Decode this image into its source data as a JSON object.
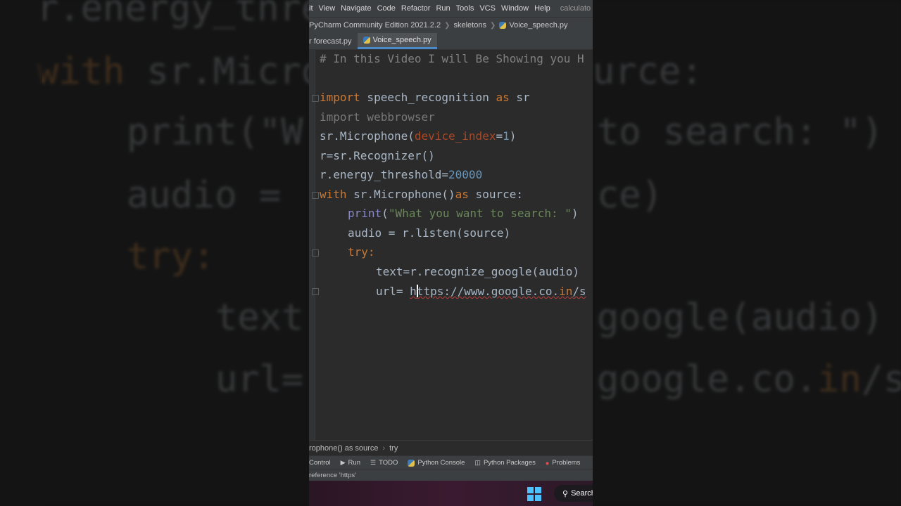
{
  "menubar": {
    "items": [
      "it",
      "View",
      "Navigate",
      "Code",
      "Refactor",
      "Run",
      "Tools",
      "VCS",
      "Window",
      "Help"
    ],
    "title_fragment": "calculato"
  },
  "breadcrumb": {
    "items": [
      "PyCharm Community Edition 2021.2.2",
      "skeletons",
      "Voice_speech.py"
    ]
  },
  "tabs": [
    {
      "label": "r forecast.py",
      "active": false
    },
    {
      "label": "Voice_speech.py",
      "active": true
    }
  ],
  "code": {
    "comment": "# In this Video I will Be Showing you H",
    "import_kw": "import",
    "import_mod": " speech_recognition ",
    "as_kw": "as",
    "import_alias": " sr",
    "import2": "import webbrowser",
    "mic_prefix": "sr.Microphone(",
    "mic_param": "device_index",
    "mic_eq": "=",
    "mic_val": "1",
    "mic_close": ")",
    "rec": "r=sr.Recognizer()",
    "thresh_prefix": "r.energy_threshold=",
    "thresh_val": "20000",
    "with_kw": "with",
    "with_body": " sr.Microphone()",
    "with_as": "as",
    "with_tail": " source:",
    "print_fn": "print",
    "print_open": "(",
    "print_str": "\"What you want to search: \"",
    "print_close": ")",
    "audio": "audio = r.listen(source)",
    "try_kw": "try",
    "try_colon": ":",
    "text_line": "text=r.recognize_google(audio)",
    "url_prefix": "url= ",
    "url_h": "h",
    "url_mid": "ttps://www.google.co.",
    "url_in": "in",
    "url_tail": "/s"
  },
  "bottom_crumbs": [
    "rophone() as source",
    "try"
  ],
  "tool_windows": [
    "Control",
    "Run",
    "TODO",
    "Python Console",
    "Python Packages",
    "Problems"
  ],
  "status_text": "reference 'https'",
  "taskbar": {
    "search_label": "Search"
  },
  "background": {
    "line1": "r.energy_thre",
    "line2_kw": "with",
    "line2_rest": " sr.Micro",
    "line2_tail": "urce:",
    "line3": "print(\"W",
    "line3_tail": "to search: \")",
    "line4": "audio = ",
    "line4_tail": "ce)",
    "line5": "try:",
    "line6": "text",
    "line6_tail": "google(audio)",
    "line7": "url=",
    "line7_tail": "google.co.",
    "line7_in": "in",
    "line7_end": "/s"
  },
  "colors": {
    "keyword": "#cc7832",
    "string": "#6a8759",
    "number": "#6897bb",
    "param": "#aa4926",
    "builtin": "#8888c6",
    "text": "#a9b7c6",
    "active_tab_underline": "#4a88c7"
  }
}
